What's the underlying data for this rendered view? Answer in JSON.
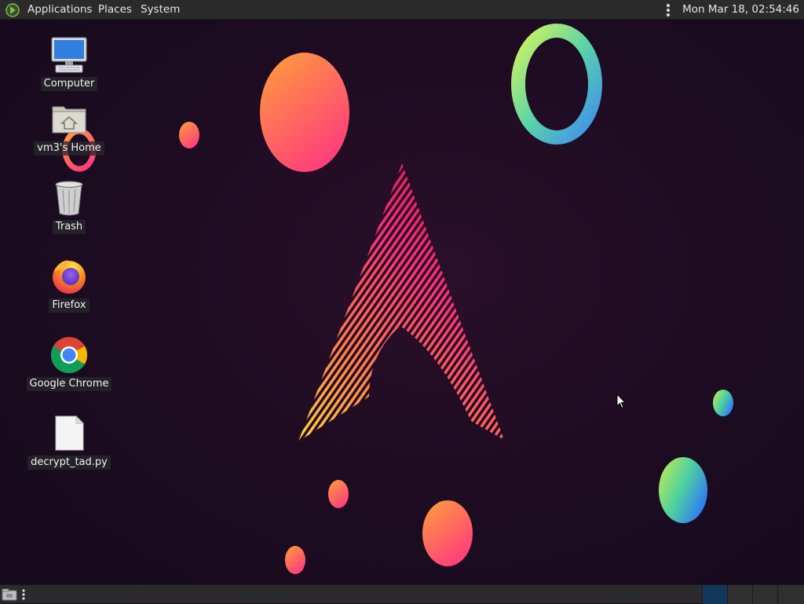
{
  "top_panel": {
    "menus": {
      "applications": "Applications",
      "places": "Places",
      "system": "System"
    },
    "clock": "Mon Mar 18, 02:54:46"
  },
  "desktop": {
    "icons": {
      "computer": "Computer",
      "home": "vm3's Home",
      "trash": "Trash",
      "firefox": "Firefox",
      "chrome": "Google Chrome",
      "file": "decrypt_tad.py"
    }
  },
  "bottom_panel": {
    "active_workspace": 1,
    "workspace_count": 4
  },
  "colors": {
    "panel": "#2b2b2b",
    "active_workspace": "#13365c",
    "background": "#1e0c22"
  }
}
